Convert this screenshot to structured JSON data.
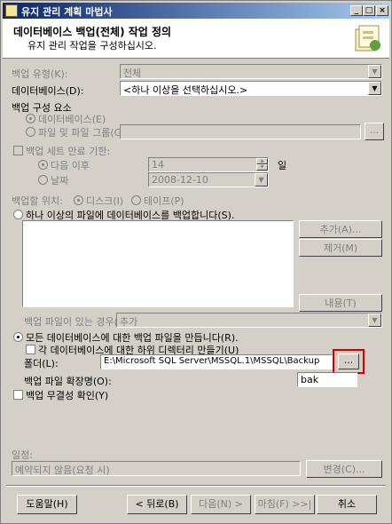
{
  "window": {
    "title": "유지 관리 계획 마법사"
  },
  "header": {
    "title": "데이터베이스 백업(전체) 작업 정의",
    "subtitle": "유지 관리 작업을 구성하십시오."
  },
  "backup_type": {
    "label": "백업 유형(K):",
    "value": "전체"
  },
  "databases": {
    "label": "데이터베이스(D):",
    "value": "<하나 이상을 선택하십시오.>"
  },
  "backup_component": {
    "label": "백업 구성 요소",
    "database_option": "데이터베이스(E)",
    "filegroup_option": "파일 및 파일 그룹(G):",
    "filegroup_button": "..."
  },
  "expiry": {
    "label": "백업 세트 만료 기한:",
    "after_label": "다음 이후",
    "after_value": "14",
    "after_unit": "일",
    "on_label": "날짜",
    "on_value": "2008-12-10"
  },
  "destination": {
    "label": "백업할 위치:",
    "disk_option": "디스크(I)",
    "tape_option": "테이프(P)"
  },
  "multi_file": {
    "label": "하나 이상의 파일에 데이터베이스를 백업합니다(S).",
    "add_button": "추가(A)...",
    "remove_button": "제거(M)",
    "contents_button": "내용(T)",
    "if_exists_label": "백업 파일이 있는 경우(X):",
    "if_exists_value": "추가"
  },
  "per_db_file": {
    "label": "모든 데이터베이스에 대한 백업 파일을 만듭니다(R).",
    "subdir_label": "각 데이터베이스에 대한 하위 디렉터리 만들기(U)",
    "folder_label": "폴더(L):",
    "folder_value": "E:\\Microsoft SQL Server\\MSSQL.1\\MSSQL\\Backup",
    "browse_button": "...",
    "ext_label": "백업 파일 확장명(O):",
    "ext_value": "bak"
  },
  "verify": {
    "label": "백업 무결성 확인(Y)"
  },
  "schedule": {
    "label": "일정:",
    "value": "예약되지 않음(요청 시)",
    "change_button": "변경(C)..."
  },
  "footer": {
    "help": "도움말(H)",
    "back": "< 뒤로(B)",
    "next": "다음(N) >",
    "finish": "마침(F) >>|",
    "cancel": "취소"
  },
  "colors": {
    "highlight": "#d40000",
    "title_start": "#0a246a",
    "title_end": "#a6caf0"
  }
}
